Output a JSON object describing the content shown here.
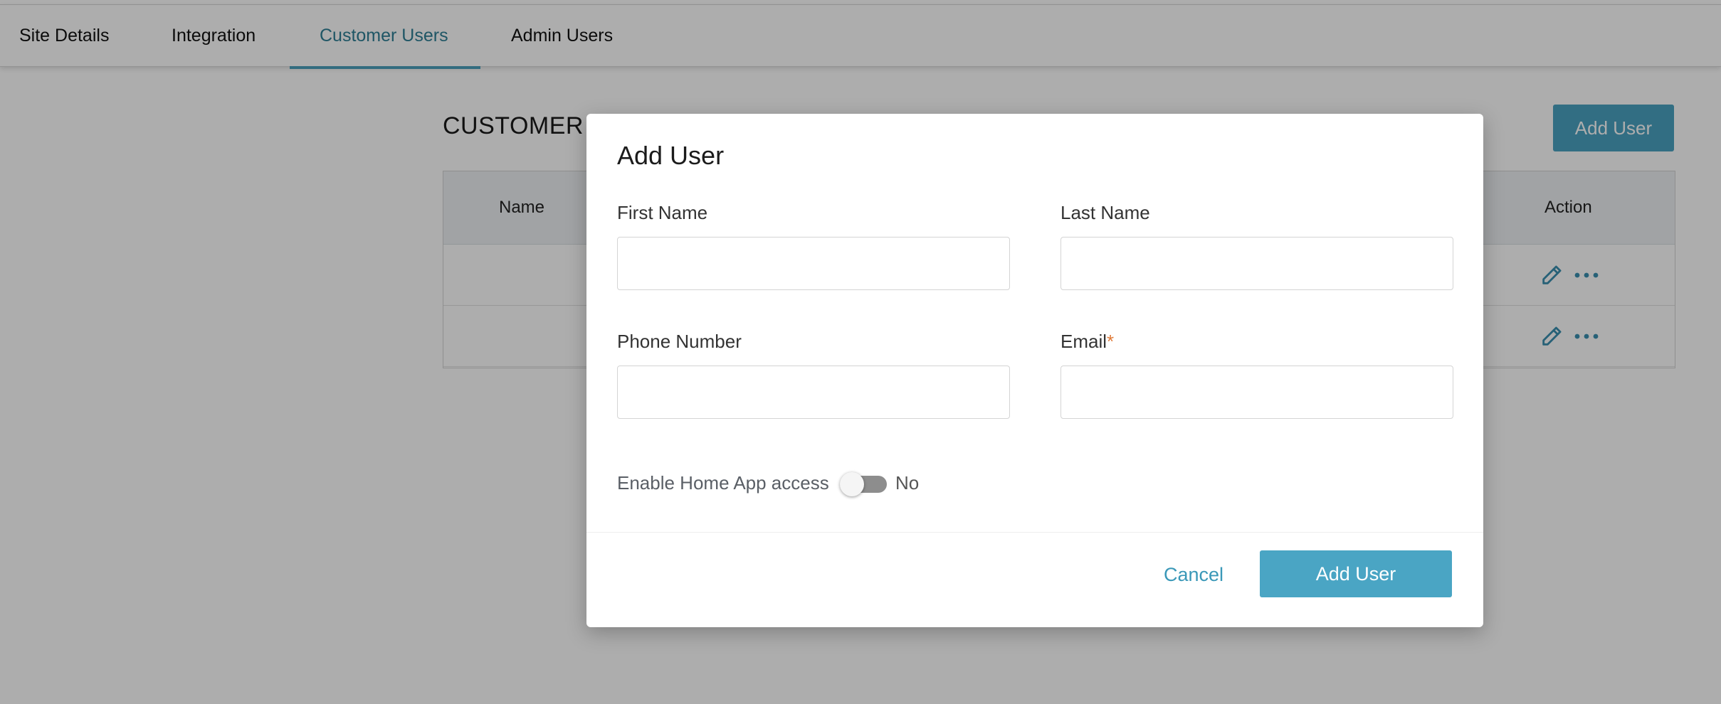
{
  "tabs": [
    {
      "label": "Site Details",
      "active": false
    },
    {
      "label": "Integration",
      "active": false
    },
    {
      "label": "Customer Users",
      "active": true
    },
    {
      "label": "Admin Users",
      "active": false
    }
  ],
  "background": {
    "section_title": "CUSTOMER U",
    "add_user_label": "Add User",
    "table": {
      "columns": [
        "Name",
        "Action"
      ],
      "row_count": 2
    }
  },
  "modal": {
    "title": "Add User",
    "fields": {
      "first_name": {
        "label": "First Name",
        "value": ""
      },
      "last_name": {
        "label": "Last Name",
        "value": ""
      },
      "phone_number": {
        "label": "Phone Number",
        "value": ""
      },
      "email": {
        "label": "Email",
        "required_marker": "*",
        "value": ""
      }
    },
    "toggle": {
      "label": "Enable Home App access",
      "state_text": "No",
      "enabled": false
    },
    "cancel_label": "Cancel",
    "submit_label": "Add User"
  },
  "colors": {
    "accent": "#4aa5c4",
    "active_tab_text": "#2f7f96",
    "required": "#e07b39"
  }
}
